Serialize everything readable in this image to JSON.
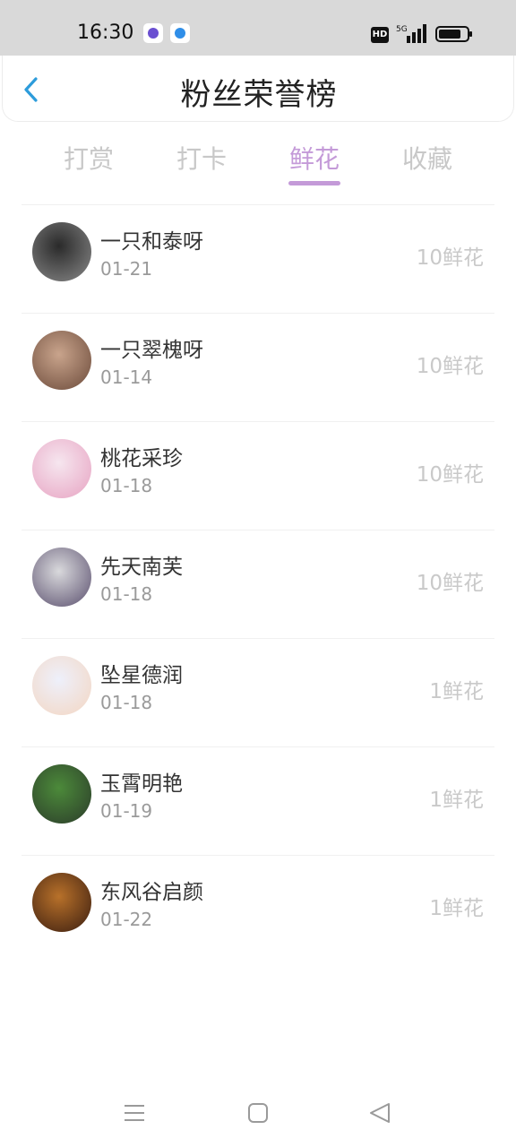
{
  "status_bar": {
    "time": "16:30",
    "hd_label": "HD",
    "network": "5G",
    "app_icons": [
      "chat-app-icon",
      "browser-app-icon"
    ]
  },
  "header": {
    "title": "粉丝荣誉榜",
    "back_icon": "chevron-left-icon",
    "accent_color": "#2d9cdb"
  },
  "tabs": [
    {
      "label": "打赏",
      "active": false
    },
    {
      "label": "打卡",
      "active": false
    },
    {
      "label": "鲜花",
      "active": true
    },
    {
      "label": "收藏",
      "active": false
    }
  ],
  "active_tab_color": "#c49ad8",
  "fans": [
    {
      "name": "一只和泰呀",
      "date": "01-21",
      "amount": "10鲜花",
      "avatar_colors": [
        "#2a2a2a",
        "#8a8a8a"
      ]
    },
    {
      "name": "一只翠槐呀",
      "date": "01-14",
      "amount": "10鲜花",
      "avatar_colors": [
        "#c9a48c",
        "#6b4a3a"
      ]
    },
    {
      "name": "桃花采珍",
      "date": "01-18",
      "amount": "10鲜花",
      "avatar_colors": [
        "#f6e6ef",
        "#e7a3c2"
      ]
    },
    {
      "name": "先天南芙",
      "date": "01-18",
      "amount": "10鲜花",
      "avatar_colors": [
        "#d9d9dc",
        "#5a4f6e"
      ]
    },
    {
      "name": "坠星德润",
      "date": "01-18",
      "amount": "1鲜花",
      "avatar_colors": [
        "#eef0fb",
        "#f3d6c2"
      ]
    },
    {
      "name": "玉霄明艳",
      "date": "01-19",
      "amount": "1鲜花",
      "avatar_colors": [
        "#4c8a3a",
        "#2b3b2a"
      ]
    },
    {
      "name": "东风谷启颜",
      "date": "01-22",
      "amount": "1鲜花",
      "avatar_colors": [
        "#b8712a",
        "#3a1d10"
      ]
    }
  ],
  "system_nav": [
    "menu-icon",
    "home-square-icon",
    "back-triangle-icon"
  ]
}
